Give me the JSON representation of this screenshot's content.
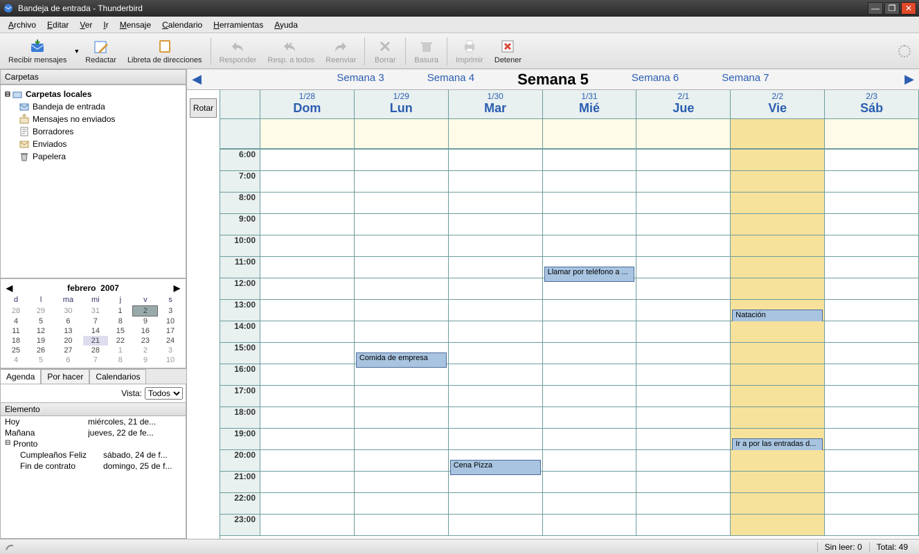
{
  "window": {
    "title": "Bandeja de entrada - Thunderbird"
  },
  "menu": [
    "Archivo",
    "Editar",
    "Ver",
    "Ir",
    "Mensaje",
    "Calendario",
    "Herramientas",
    "Ayuda"
  ],
  "toolbar": [
    {
      "id": "recibir",
      "label": "Recibir mensajes",
      "icon": "mail-receive",
      "dropdown": true
    },
    {
      "id": "redactar",
      "label": "Redactar",
      "icon": "compose"
    },
    {
      "id": "libreta",
      "label": "Libreta de direcciones",
      "icon": "addressbook"
    },
    {
      "sep": true
    },
    {
      "id": "responder",
      "label": "Responder",
      "icon": "reply",
      "disabled": true
    },
    {
      "id": "resptodos",
      "label": "Resp. a todos",
      "icon": "replyall",
      "disabled": true
    },
    {
      "id": "reenviar",
      "label": "Reenviar",
      "icon": "forward",
      "disabled": true
    },
    {
      "sep": true
    },
    {
      "id": "borrar",
      "label": "Borrar",
      "icon": "delete",
      "disabled": true
    },
    {
      "sep": true
    },
    {
      "id": "basura",
      "label": "Basura",
      "icon": "junk",
      "disabled": true
    },
    {
      "sep": true
    },
    {
      "id": "imprimir",
      "label": "Imprimir",
      "icon": "print",
      "disabled": true
    },
    {
      "id": "detener",
      "label": "Detener",
      "icon": "stop"
    }
  ],
  "folders": {
    "header": "Carpetas",
    "root": "Carpetas locales",
    "items": [
      {
        "label": "Bandeja de entrada",
        "icon": "inbox"
      },
      {
        "label": "Mensajes no enviados",
        "icon": "outbox"
      },
      {
        "label": "Borradores",
        "icon": "drafts"
      },
      {
        "label": "Enviados",
        "icon": "sent"
      },
      {
        "label": "Papelera",
        "icon": "trash"
      }
    ]
  },
  "minical": {
    "month": "febrero",
    "year": "2007",
    "dow": [
      "d",
      "l",
      "ma",
      "mi",
      "j",
      "v",
      "s"
    ],
    "weeks": [
      [
        {
          "d": 28,
          "o": true
        },
        {
          "d": 29,
          "o": true
        },
        {
          "d": 30,
          "o": true
        },
        {
          "d": 31,
          "o": true
        },
        {
          "d": 1
        },
        {
          "d": 2,
          "sel": true
        },
        {
          "d": 3
        }
      ],
      [
        {
          "d": 4
        },
        {
          "d": 5
        },
        {
          "d": 6
        },
        {
          "d": 7
        },
        {
          "d": 8
        },
        {
          "d": 9
        },
        {
          "d": 10
        }
      ],
      [
        {
          "d": 11
        },
        {
          "d": 12
        },
        {
          "d": 13
        },
        {
          "d": 14
        },
        {
          "d": 15
        },
        {
          "d": 16
        },
        {
          "d": 17
        }
      ],
      [
        {
          "d": 18
        },
        {
          "d": 19
        },
        {
          "d": 20
        },
        {
          "d": 21,
          "today": true
        },
        {
          "d": 22
        },
        {
          "d": 23
        },
        {
          "d": 24
        }
      ],
      [
        {
          "d": 25
        },
        {
          "d": 26
        },
        {
          "d": 27
        },
        {
          "d": 28
        },
        {
          "d": 1,
          "o": true
        },
        {
          "d": 2,
          "o": true
        },
        {
          "d": 3,
          "o": true
        }
      ],
      [
        {
          "d": 4,
          "o": true
        },
        {
          "d": 5,
          "o": true
        },
        {
          "d": 6,
          "o": true
        },
        {
          "d": 7,
          "o": true
        },
        {
          "d": 8,
          "o": true
        },
        {
          "d": 9,
          "o": true
        },
        {
          "d": 10,
          "o": true
        }
      ]
    ]
  },
  "agendaTabs": [
    "Agenda",
    "Por hacer",
    "Calendarios"
  ],
  "agenda": {
    "vistaLabel": "Vista:",
    "vistaValue": "Todos",
    "header": "Elemento",
    "rows": [
      {
        "label": "Hoy",
        "date": "miércoles, 21 de..."
      },
      {
        "label": "Mañana",
        "date": "jueves, 22 de fe..."
      },
      {
        "label": "Pronto",
        "group": true
      },
      {
        "label": "Cumpleaños Feliz",
        "date": "sábado, 24 de f...",
        "indent": true
      },
      {
        "label": "Fin de contrato",
        "date": "domingo, 25 de f...",
        "indent": true
      }
    ]
  },
  "weekNav": [
    "Semana 3",
    "Semana 4",
    "Semana 5",
    "Semana 6",
    "Semana 7"
  ],
  "weekCurrent": 2,
  "rotateLabel": "Rotar",
  "days": [
    {
      "date": "1/28",
      "dow": "Dom"
    },
    {
      "date": "1/29",
      "dow": "Lun"
    },
    {
      "date": "1/30",
      "dow": "Mar"
    },
    {
      "date": "1/31",
      "dow": "Mié"
    },
    {
      "date": "2/1",
      "dow": "Jue"
    },
    {
      "date": "2/2",
      "dow": "Vie",
      "today": true
    },
    {
      "date": "2/3",
      "dow": "Sáb"
    }
  ],
  "hours": [
    "6:00",
    "7:00",
    "8:00",
    "9:00",
    "10:00",
    "11:00",
    "12:00",
    "13:00",
    "14:00",
    "15:00",
    "16:00",
    "17:00",
    "18:00",
    "19:00",
    "20:00",
    "21:00",
    "22:00",
    "23:00"
  ],
  "events": [
    {
      "day": 3,
      "hour": "11:00",
      "label": "Llamar por teléfono a ...",
      "half": true
    },
    {
      "day": 1,
      "hour": "15:00",
      "label": "Comida de empresa",
      "half": true
    },
    {
      "day": 5,
      "hour": "13:00",
      "label": "Natación",
      "half": true
    },
    {
      "day": 5,
      "hour": "19:00",
      "label": "Ir a por las entradas d...",
      "half": true
    },
    {
      "day": 2,
      "hour": "20:00",
      "label": "Cena Pizza",
      "half": true
    }
  ],
  "status": {
    "unread": "Sin leer: 0",
    "total": "Total: 49"
  }
}
